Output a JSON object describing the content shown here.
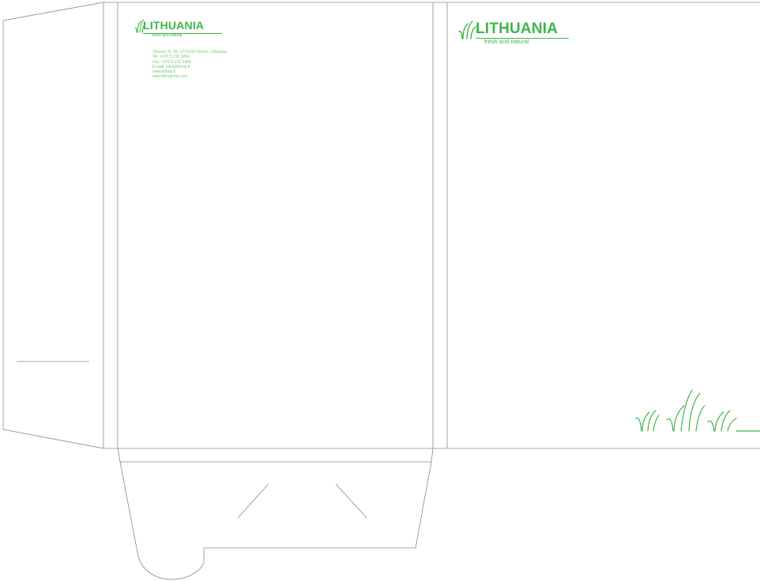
{
  "brand": {
    "name": "LITHUANIA",
    "tagline": "fresh and natural"
  },
  "contact": {
    "lines": [
      "Vilniaus St. 99, LT-01119 Vilnius, Lithuania",
      "Tel. +370 5 212 3456",
      "Fax. +370 5 212 3456",
      "E-mail: info@litfood.lt",
      "www.litfood.lt",
      "www.litfood-fair.com"
    ]
  },
  "colors": {
    "brand_green": "#3cb74a",
    "contact_green": "#6fcf6f",
    "dieline": "#8a8a8a"
  }
}
